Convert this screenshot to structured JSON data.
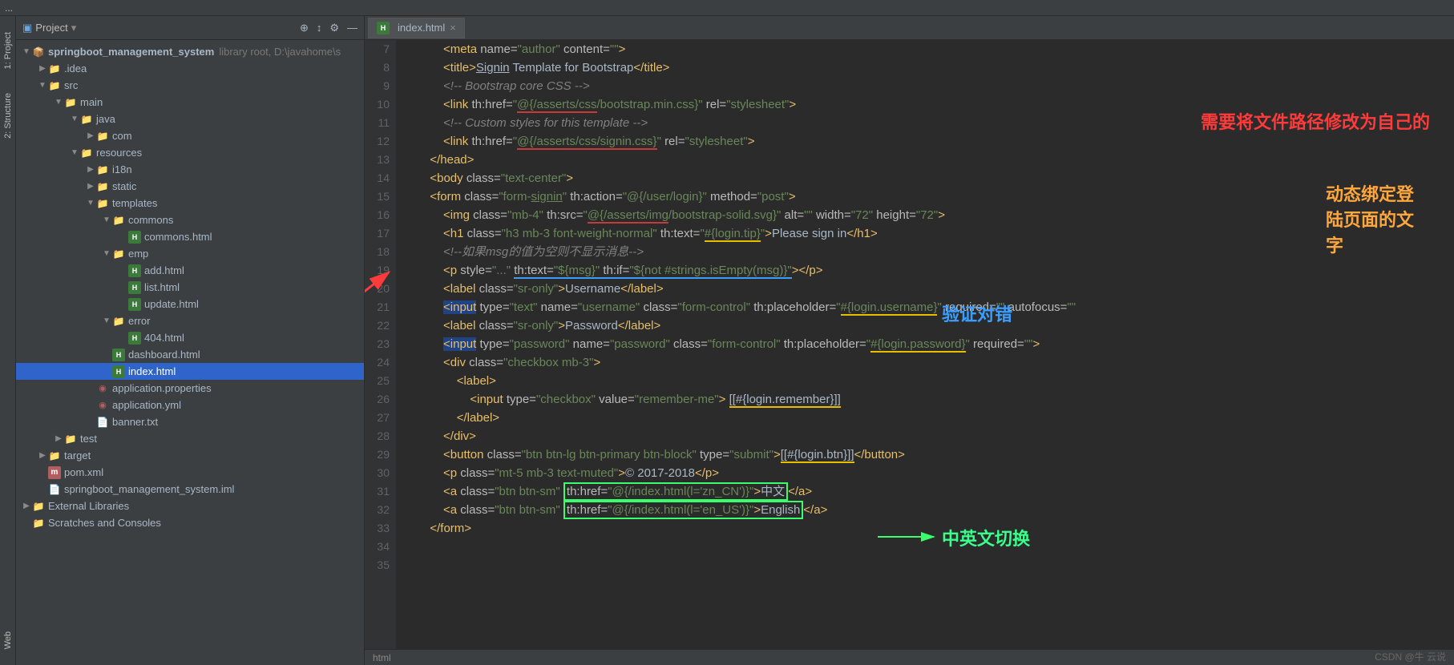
{
  "panel": {
    "project_label": "Project"
  },
  "tabs": {
    "sidebar": [
      "1: Project",
      "2: Structure",
      "Web"
    ]
  },
  "tree": {
    "root": {
      "name": "springboot_management_system",
      "hint": "library root,  D:\\javahome\\s"
    },
    "idea": ".idea",
    "src": "src",
    "main": "main",
    "java": "java",
    "com": "com",
    "resources": "resources",
    "i18n": "i18n",
    "static": "static",
    "templates": "templates",
    "commons": "commons",
    "commons_html": "commons.html",
    "emp": "emp",
    "add_html": "add.html",
    "list_html": "list.html",
    "update_html": "update.html",
    "error": "error",
    "404_html": "404.html",
    "dashboard_html": "dashboard.html",
    "index_html": "index.html",
    "app_props": "application.properties",
    "app_yml": "application.yml",
    "banner": "banner.txt",
    "test": "test",
    "target": "target",
    "pom": "pom.xml",
    "iml": "springboot_management_system.iml",
    "ext_lib": "External Libraries",
    "scratches": "Scratches and Consoles"
  },
  "editor_tab": "index.html",
  "lines": [
    "7",
    "8",
    "9",
    "10",
    "11",
    "12",
    "13",
    "14",
    "15",
    "16",
    "17",
    "18",
    "19",
    "20",
    "21",
    "22",
    "23",
    "24",
    "25",
    "26",
    "27",
    "28",
    "29",
    "30",
    "31",
    "32",
    "33",
    "34",
    "35"
  ],
  "code": [
    {
      "indent": 3,
      "html": "<span class='tag'>&lt;meta</span> <span class='attr'>name=</span><span class='str'>\"author\"</span> <span class='attr'>content=</span><span class='str'>\"\"</span><span class='tag'>&gt;</span>"
    },
    {
      "indent": 3,
      "html": "<span class='tag'>&lt;title&gt;</span><span class='txt'><u>Signin</u> Template for Bootstrap</span><span class='tag'>&lt;/title&gt;</span>"
    },
    {
      "indent": 3,
      "html": "<span class='cmt'>&lt;!-- Bootstrap core CSS --&gt;</span>"
    },
    {
      "indent": 3,
      "html": "<span class='tag'>&lt;link</span> <span class='attr'>th:href=</span><span class='str'>\"<span class='ul-red'>@{/asserts/css</span>/bootstrap.min.css<span>}</span>\"</span> <span class='attr'>rel=</span><span class='str'>\"stylesheet\"</span><span class='tag'>&gt;</span>"
    },
    {
      "indent": 3,
      "html": "<span class='cmt'>&lt;!-- Custom styles for this template --&gt;</span>"
    },
    {
      "indent": 3,
      "html": "<span class='tag'>&lt;link</span> <span class='attr'>th:href=</span><span class='str'>\"<span class='ul-red'>@{/asserts/css/signin.css}</span>\"</span> <span class='attr'>rel=</span><span class='str'>\"stylesheet\"</span><span class='tag'>&gt;</span>"
    },
    {
      "indent": 2,
      "html": "<span class='tag'>&lt;/head&gt;</span>"
    },
    {
      "indent": 0,
      "html": ""
    },
    {
      "indent": 0,
      "html": ""
    },
    {
      "indent": 2,
      "html": "<span class='tag'>&lt;body</span> <span class='attr'>class=</span><span class='str'>\"text-center\"</span><span class='tag'>&gt;</span>"
    },
    {
      "indent": 2,
      "html": "<span class='tag'>&lt;form</span> <span class='attr'>class=</span><span class='str'>\"form-<u>signin</u>\"</span> <span class='attr'>th:action=</span><span class='str'>\"@{/user/login}\"</span> <span class='attr'>method=</span><span class='str'>\"post\"</span><span class='tag'>&gt;</span>"
    },
    {
      "indent": 3,
      "html": "<span class='tag'>&lt;img</span> <span class='attr'>class=</span><span class='str'>\"mb-4\"</span> <span class='attr'>th:src=</span><span class='str'>\"<span class='ul-red'>@{/asserts/img</span>/bootstrap-solid.svg<span>}</span>\"</span> <span class='attr'>alt=</span><span class='str'>\"\"</span> <span class='attr'>width=</span><span class='str'>\"72\"</span> <span class='attr'>height=</span><span class='str'>\"72\"</span><span class='tag'>&gt;</span>"
    },
    {
      "indent": 3,
      "html": "<span class='tag'>&lt;h1</span> <span class='attr'>class=</span><span class='str'>\"h3 mb-3 font-weight-normal\"</span> <span class='attr'>th:text=</span><span class='str'>\"<span class='ul-yellow'>#{login.tip}</span>\"</span><span class='tag'>&gt;</span><span class='txt'>Please sign in</span><span class='tag'>&lt;/h1&gt;</span>"
    },
    {
      "indent": 3,
      "html": "<span class='cmt'>&lt;!--如果msg的值为空则不显示消息--&gt;</span>"
    },
    {
      "indent": 3,
      "html": "<span class='tag'>&lt;p</span> <span class='attr'>style=</span><span class='str'>\"...\"</span> <span class='ul-blue'><span class='attr'>th:text=</span><span class='str'>\"${msg}\"</span> <span class='attr'>th:if=</span><span class='str'>\"${not #strings.isEmpty(msg)}\"</span></span><span class='tag'>&gt;&lt;/p&gt;</span>"
    },
    {
      "indent": 3,
      "html": "<span class='tag'>&lt;label</span> <span class='attr'>class=</span><span class='str'>\"sr-only\"</span><span class='tag'>&gt;</span><span class='txt'>Username</span><span class='tag'>&lt;/label&gt;</span>"
    },
    {
      "indent": 3,
      "html": "<span style='background:#214283' class='tag'>&lt;input</span> <span class='attr'>type=</span><span class='str'>\"text\"</span> <span class='attr'>name=</span><span class='str'>\"username\"</span> <span class='attr'>class=</span><span class='str'>\"form-control\"</span> <span class='attr'>th:placeholder=</span><span class='str'>\"<span class='ul-yellow'>#{login.username}</span>\"</span> <span class='attr'>required=</span><span class='str'>\"\"</span> <span class='attr'>autofocus=</span><span class='str'>\"\"</span>"
    },
    {
      "indent": 3,
      "html": "<span class='tag'>&lt;label</span> <span class='attr'>class=</span><span class='str'>\"sr-only\"</span><span class='tag'>&gt;</span><span class='txt'>Password</span><span class='tag'>&lt;/label&gt;</span>"
    },
    {
      "indent": 3,
      "html": "<span style='background:#214283' class='tag'>&lt;input</span> <span class='attr'>type=</span><span class='str'>\"password\"</span> <span class='attr'>name=</span><span class='str'>\"password\"</span> <span class='attr'>class=</span><span class='str'>\"form-control\"</span> <span class='attr'>th:placeholder=</span><span class='str'>\"<span class='ul-yellow'>#{login.password}</span>\"</span> <span class='attr'>required=</span><span class='str'>\"\"</span><span class='tag'>&gt;</span>"
    },
    {
      "indent": 3,
      "html": "<span class='tag'>&lt;div</span> <span class='attr'>class=</span><span class='str'>\"checkbox mb-3\"</span><span class='tag'>&gt;</span>"
    },
    {
      "indent": 4,
      "html": "<span class='tag'>&lt;label&gt;</span>"
    },
    {
      "indent": 5,
      "html": "<span class='tag'>&lt;input</span> <span class='attr'>type=</span><span class='str'>\"checkbox\"</span> <span class='attr'>value=</span><span class='str'>\"remember-me\"</span><span class='tag'>&gt;</span> <span class='txt'><span class='ul-yellow'>[[#{login.remember}]]</span></span>"
    },
    {
      "indent": 4,
      "html": "<span class='tag'>&lt;/label&gt;</span>"
    },
    {
      "indent": 3,
      "html": "<span class='tag'>&lt;/div&gt;</span>"
    },
    {
      "indent": 3,
      "html": "<span class='tag'>&lt;button</span> <span class='attr'>class=</span><span class='str'>\"btn btn-lg btn-primary btn-block\"</span> <span class='attr'>type=</span><span class='str'>\"submit\"</span><span class='tag'>&gt;</span><span class='txt'><span class='ul-yellow'>[[#{login.btn}]]</span></span><span class='tag'>&lt;/button&gt;</span>"
    },
    {
      "indent": 3,
      "html": "<span class='tag'>&lt;p</span> <span class='attr'>class=</span><span class='str'>\"mt-5 mb-3 text-muted\"</span><span class='tag'>&gt;</span><span class='txt'>© 2017-2018</span><span class='tag'>&lt;/p&gt;</span>"
    },
    {
      "indent": 3,
      "html": "<span class='tag'>&lt;a</span> <span class='attr'>class=</span><span class='str'>\"btn btn-sm\"</span> <span class='box-green'><span class='attr'>th:href=</span><span class='str'>\"@{/index.html(l='zn_CN')}\"</span><span class='tag'>&gt;</span><span class='txt'>中文</span></span><span class='tag'>&lt;/a&gt;</span>"
    },
    {
      "indent": 3,
      "html": "<span class='tag'>&lt;a</span> <span class='attr'>class=</span><span class='str'>\"btn btn-sm\"</span> <span class='box-green'><span class='attr'>th:href=</span><span class='str'>\"@{/index.html(l='en_US')}\"</span><span class='tag'>&gt;</span><span class='txt'>English</span></span><span class='tag'>&lt;/a&gt;</span>"
    },
    {
      "indent": 2,
      "html": "<span class='tag'>&lt;/form&gt;</span>"
    }
  ],
  "annots": {
    "red": "需要将文件路径修改为自己的",
    "yellow": "动态绑定登陆页面的文字",
    "blue": "验证对错",
    "green": "中英文切换"
  },
  "breadcrumb": "html",
  "watermark": "CSDN @牛 云说"
}
